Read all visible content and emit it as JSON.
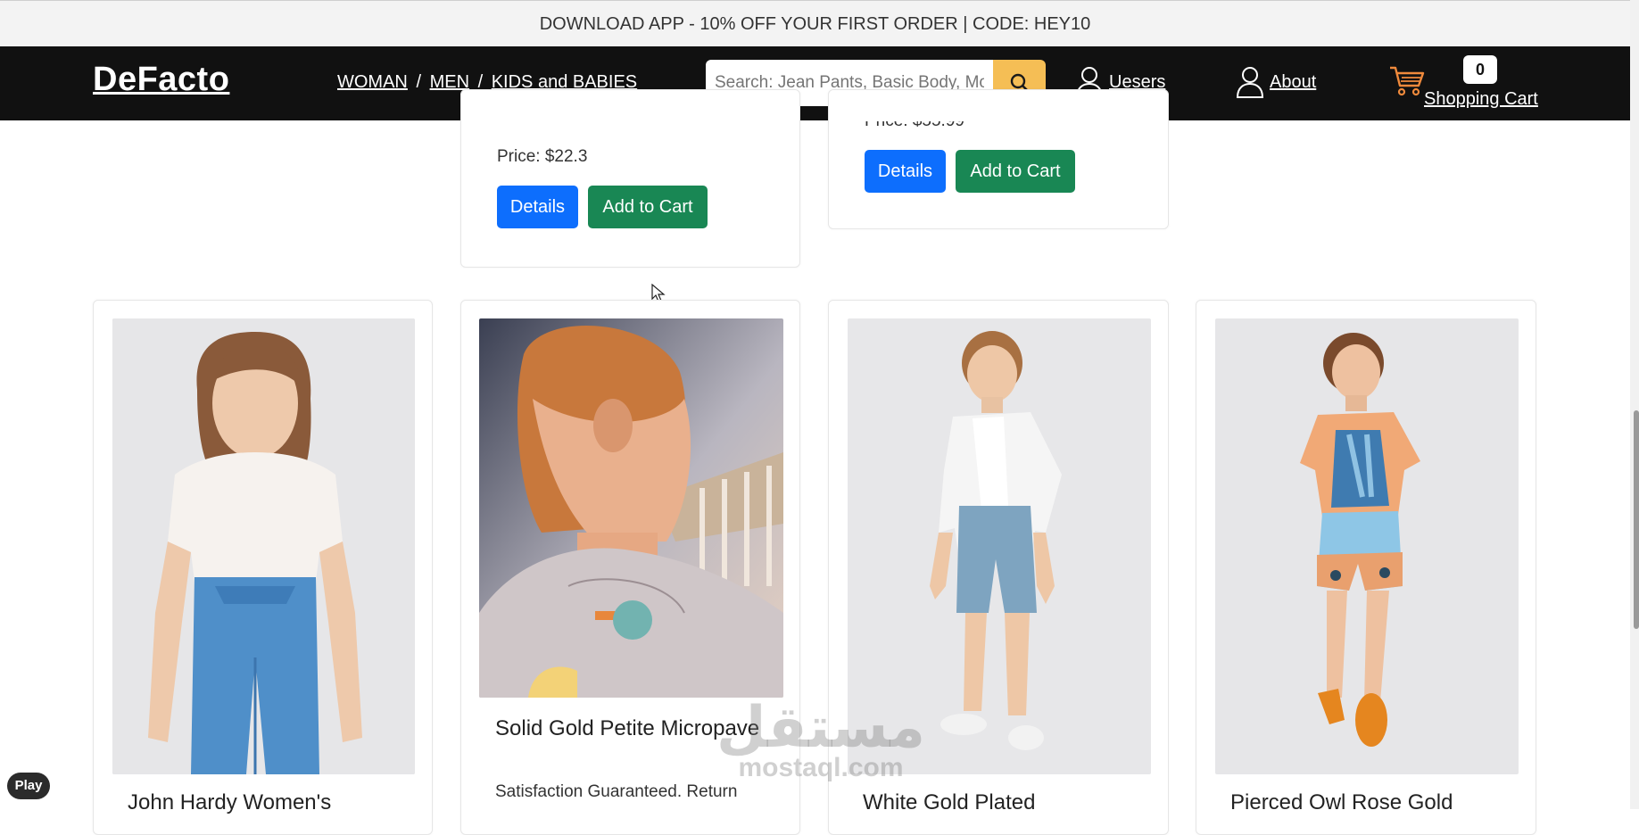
{
  "announcement": "DOWNLOAD APP - 10% OFF YOUR FIRST ORDER | CODE: HEY10",
  "navbar": {
    "brand": "DeFacto",
    "categories": [
      "WOMAN",
      "MEN",
      "KIDS and BABIES"
    ],
    "separator": "/",
    "search_placeholder": "Search: Jean Pants, Basic Body, Mo",
    "users_label": "Uesers",
    "about_label": "About",
    "cart_count": "0",
    "cart_label": "Shopping Cart"
  },
  "top_cards": [
    {
      "price": "Price: $22.3",
      "details_label": "Details",
      "add_label": "Add to Cart"
    },
    {
      "price": "Price: $55.99",
      "details_label": "Details",
      "add_label": "Add to Cart"
    }
  ],
  "products": [
    {
      "title": "John Hardy Women's",
      "desc": ""
    },
    {
      "title": "Solid Gold Petite Micropave",
      "desc": "Satisfaction Guaranteed. Return"
    },
    {
      "title": "White Gold Plated",
      "desc": ""
    },
    {
      "title": "Pierced Owl Rose Gold",
      "desc": ""
    }
  ],
  "overlay": {
    "play_label": "Play",
    "watermark_ar": "مستقل",
    "watermark_en": "mostaql.com"
  },
  "colors": {
    "navbar": "#111111",
    "search_button": "#f5be55",
    "details_button": "#0d6efd",
    "add_button": "#198754"
  }
}
